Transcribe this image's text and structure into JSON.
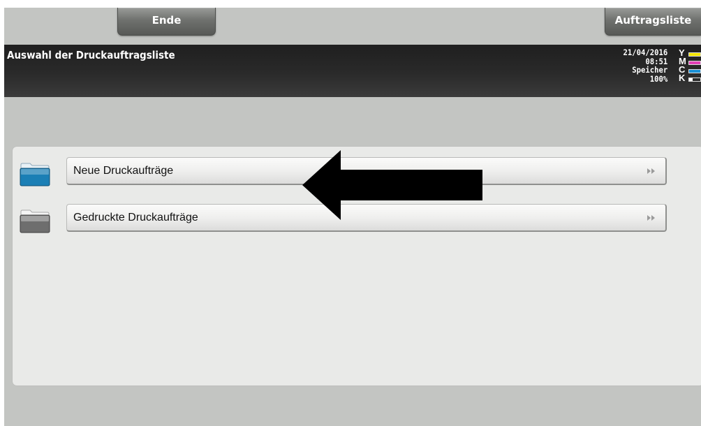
{
  "top_bar": {
    "end_label": "Ende",
    "job_list_label": "Auftragsliste"
  },
  "header": {
    "title": "Auswahl der Druckauftragsliste",
    "date": "21/04/2016",
    "time": "08:51",
    "memory_label": "Speicher",
    "memory_value": "100%"
  },
  "toner": [
    {
      "letter": "Y",
      "color": "#f2e400"
    },
    {
      "letter": "M",
      "color": "#e33fb6"
    },
    {
      "letter": "C",
      "color": "#1a8fd4"
    },
    {
      "letter": "K",
      "color": "#ffffff"
    }
  ],
  "folders": [
    {
      "label": "Neue Druckaufträge",
      "icon": "folder-blue-icon",
      "color": "#1b7fb5"
    },
    {
      "label": "Gedruckte Druckaufträge",
      "icon": "folder-gray-icon",
      "color": "#6e6e6e"
    }
  ]
}
